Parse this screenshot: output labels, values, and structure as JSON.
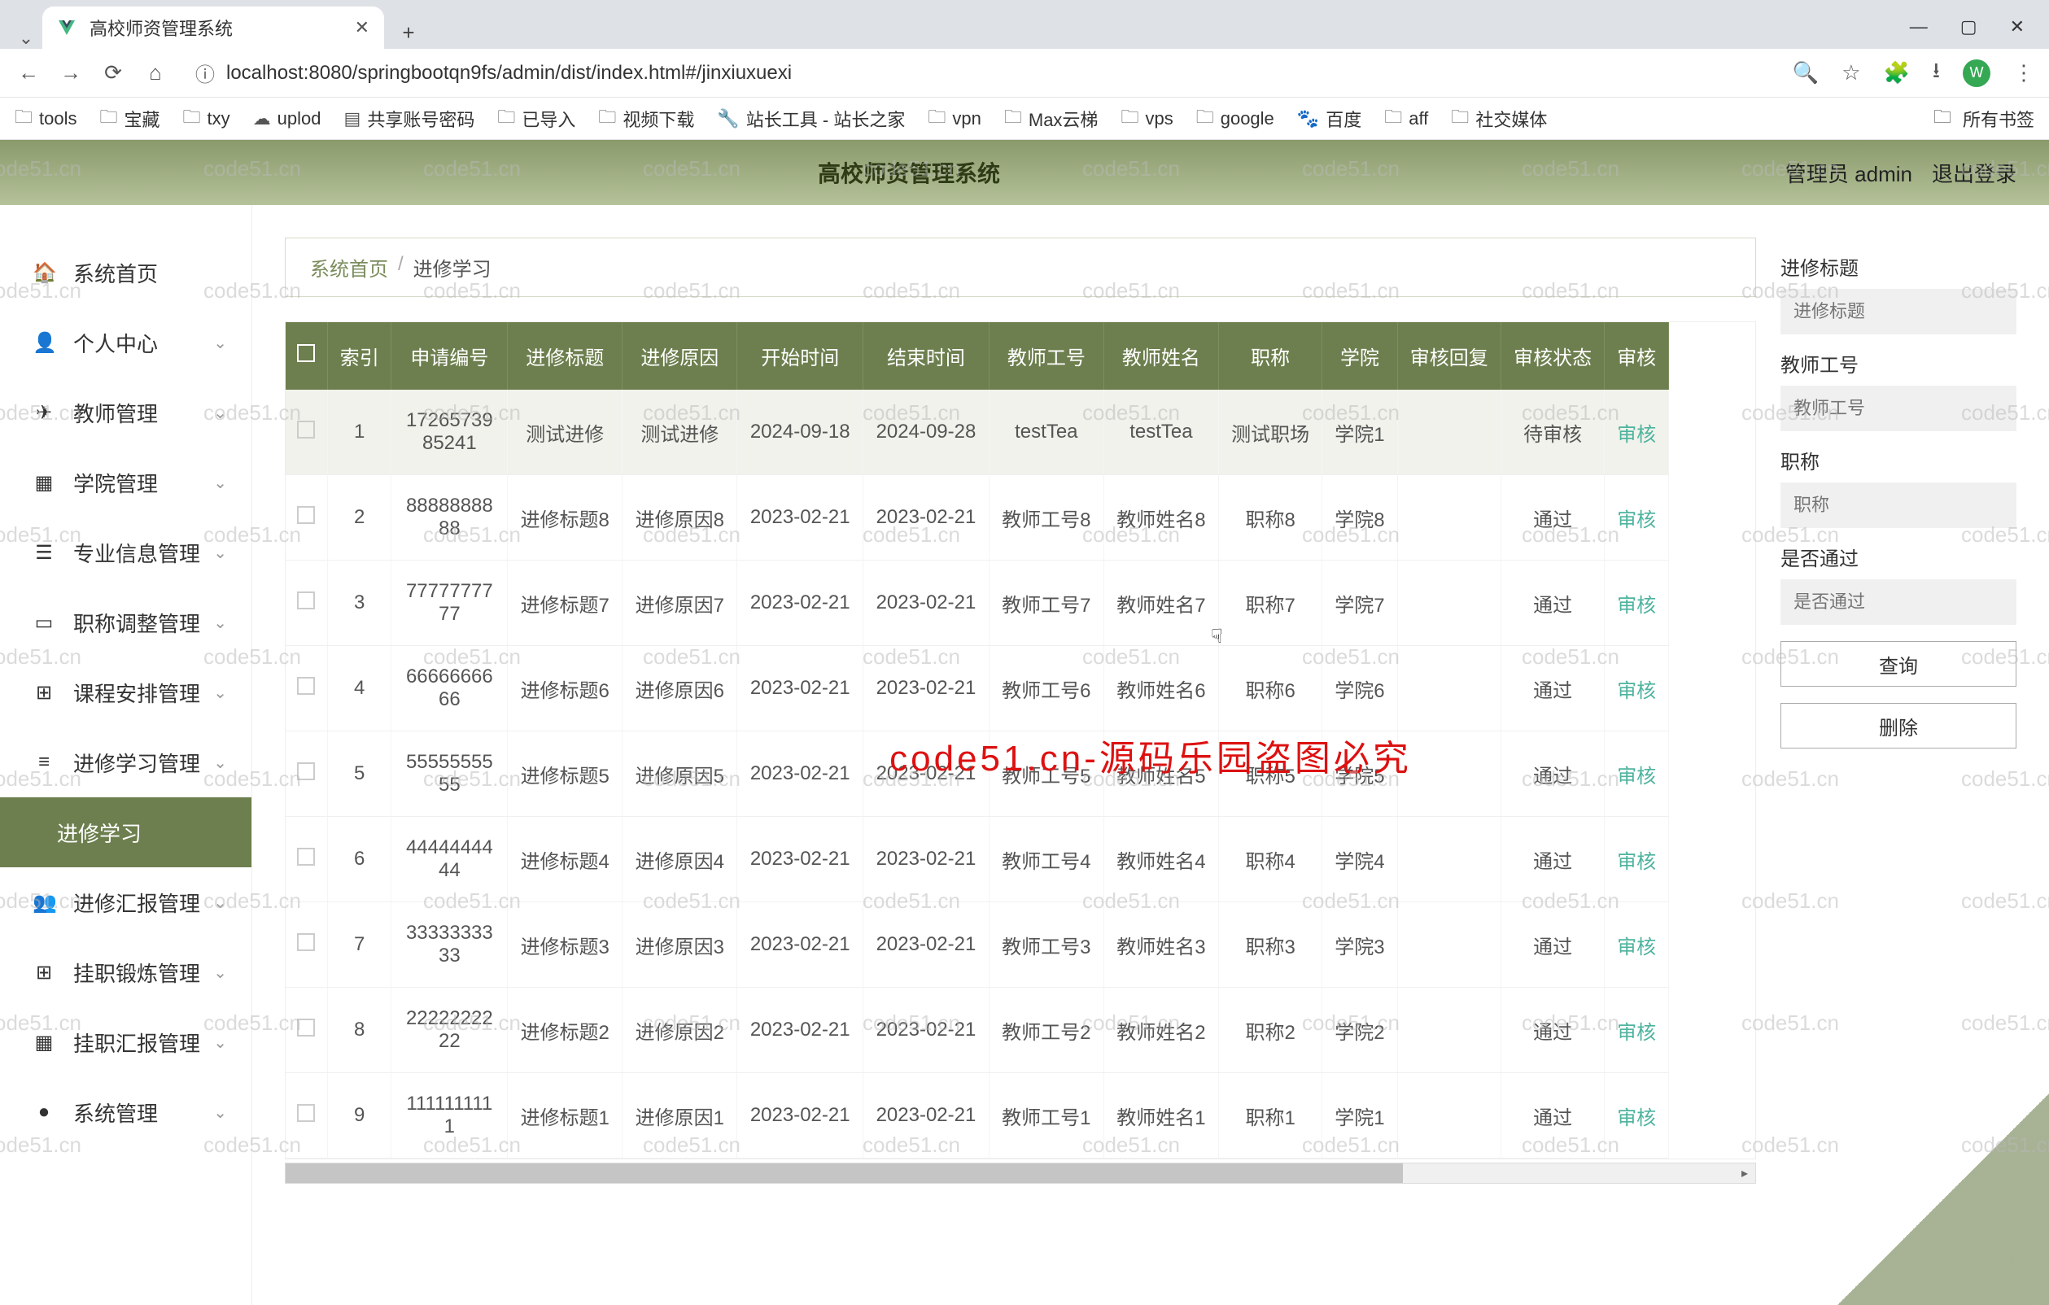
{
  "browser": {
    "tab_title": "高校师资管理系统",
    "url": "localhost:8080/springbootqn9fs/admin/dist/index.html#/jinxiuxuexi",
    "avatar_letter": "W",
    "bookmarks": [
      {
        "label": "tools",
        "icon": "folder"
      },
      {
        "label": "宝藏",
        "icon": "folder"
      },
      {
        "label": "txy",
        "icon": "folder"
      },
      {
        "label": "uplod",
        "icon": "cloud"
      },
      {
        "label": "共享账号密码",
        "icon": "sheet"
      },
      {
        "label": "已导入",
        "icon": "folder"
      },
      {
        "label": "视频下载",
        "icon": "folder"
      },
      {
        "label": "站长工具 - 站长之家",
        "icon": "tool"
      },
      {
        "label": "vpn",
        "icon": "folder"
      },
      {
        "label": "Max云梯",
        "icon": "folder"
      },
      {
        "label": "vps",
        "icon": "folder"
      },
      {
        "label": "google",
        "icon": "folder"
      },
      {
        "label": "百度",
        "icon": "paw"
      },
      {
        "label": "aff",
        "icon": "folder"
      },
      {
        "label": "社交媒体",
        "icon": "folder"
      }
    ],
    "all_bookmarks": "所有书签"
  },
  "app": {
    "title": "高校师资管理系统",
    "user_role": "管理员 admin",
    "logout": "退出登录"
  },
  "sidebar": {
    "items": [
      {
        "label": "系统首页",
        "icon": "🏠",
        "expandable": false
      },
      {
        "label": "个人中心",
        "icon": "👤",
        "expandable": true
      },
      {
        "label": "教师管理",
        "icon": "✈",
        "expandable": true
      },
      {
        "label": "学院管理",
        "icon": "▦",
        "expandable": true
      },
      {
        "label": "专业信息管理",
        "icon": "☰",
        "expandable": true
      },
      {
        "label": "职称调整管理",
        "icon": "▭",
        "expandable": true
      },
      {
        "label": "课程安排管理",
        "icon": "⊞",
        "expandable": true
      },
      {
        "label": "进修学习管理",
        "icon": "≡",
        "expandable": true
      },
      {
        "label": "进修学习",
        "icon": "",
        "expandable": false,
        "active": true,
        "sub": true
      },
      {
        "label": "进修汇报管理",
        "icon": "👥",
        "expandable": true
      },
      {
        "label": "挂职锻炼管理",
        "icon": "⊞",
        "expandable": true
      },
      {
        "label": "挂职汇报管理",
        "icon": "▦",
        "expandable": true
      },
      {
        "label": "系统管理",
        "icon": "●",
        "expandable": true
      }
    ]
  },
  "breadcrumb": {
    "home": "系统首页",
    "current": "进修学习"
  },
  "table": {
    "headers": [
      "",
      "索引",
      "申请编号",
      "进修标题",
      "进修原因",
      "开始时间",
      "结束时间",
      "教师工号",
      "教师姓名",
      "职称",
      "学院",
      "审核回复",
      "审核状态",
      "审核"
    ],
    "rows": [
      {
        "idx": "1",
        "sn": "1726573985241",
        "title": "测试进修",
        "reason": "测试进修",
        "start": "2024-09-18",
        "end": "2024-09-28",
        "tid": "testTea",
        "tname": "testTea",
        "rank": "测试职场",
        "college": "学院1",
        "reply": "",
        "status": "待审核",
        "audit": "审核",
        "sel": true
      },
      {
        "idx": "2",
        "sn": "8888888888",
        "title": "进修标题8",
        "reason": "进修原因8",
        "start": "2023-02-21",
        "end": "2023-02-21",
        "tid": "教师工号8",
        "tname": "教师姓名8",
        "rank": "职称8",
        "college": "学院8",
        "reply": "",
        "status": "通过",
        "audit": "审核"
      },
      {
        "idx": "3",
        "sn": "7777777777",
        "title": "进修标题7",
        "reason": "进修原因7",
        "start": "2023-02-21",
        "end": "2023-02-21",
        "tid": "教师工号7",
        "tname": "教师姓名7",
        "rank": "职称7",
        "college": "学院7",
        "reply": "",
        "status": "通过",
        "audit": "审核"
      },
      {
        "idx": "4",
        "sn": "6666666666",
        "title": "进修标题6",
        "reason": "进修原因6",
        "start": "2023-02-21",
        "end": "2023-02-21",
        "tid": "教师工号6",
        "tname": "教师姓名6",
        "rank": "职称6",
        "college": "学院6",
        "reply": "",
        "status": "通过",
        "audit": "审核"
      },
      {
        "idx": "5",
        "sn": "5555555555",
        "title": "进修标题5",
        "reason": "进修原因5",
        "start": "2023-02-21",
        "end": "2023-02-21",
        "tid": "教师工号5",
        "tname": "教师姓名5",
        "rank": "职称5",
        "college": "学院5",
        "reply": "",
        "status": "通过",
        "audit": "审核"
      },
      {
        "idx": "6",
        "sn": "4444444444",
        "title": "进修标题4",
        "reason": "进修原因4",
        "start": "2023-02-21",
        "end": "2023-02-21",
        "tid": "教师工号4",
        "tname": "教师姓名4",
        "rank": "职称4",
        "college": "学院4",
        "reply": "",
        "status": "通过",
        "audit": "审核"
      },
      {
        "idx": "7",
        "sn": "3333333333",
        "title": "进修标题3",
        "reason": "进修原因3",
        "start": "2023-02-21",
        "end": "2023-02-21",
        "tid": "教师工号3",
        "tname": "教师姓名3",
        "rank": "职称3",
        "college": "学院3",
        "reply": "",
        "status": "通过",
        "audit": "审核"
      },
      {
        "idx": "8",
        "sn": "2222222222",
        "title": "进修标题2",
        "reason": "进修原因2",
        "start": "2023-02-21",
        "end": "2023-02-21",
        "tid": "教师工号2",
        "tname": "教师姓名2",
        "rank": "职称2",
        "college": "学院2",
        "reply": "",
        "status": "通过",
        "audit": "审核"
      },
      {
        "idx": "9",
        "sn": "1111111111",
        "title": "进修标题1",
        "reason": "进修原因1",
        "start": "2023-02-21",
        "end": "2023-02-21",
        "tid": "教师工号1",
        "tname": "教师姓名1",
        "rank": "职称1",
        "college": "学院1",
        "reply": "",
        "status": "通过",
        "audit": "审核"
      }
    ]
  },
  "filter": {
    "labels": {
      "title": "进修标题",
      "tid": "教师工号",
      "rank": "职称",
      "pass": "是否通过"
    },
    "placeholders": {
      "title": "进修标题",
      "tid": "教师工号",
      "rank": "职称",
      "pass": "是否通过"
    },
    "btn_query": "查询",
    "btn_delete": "删除"
  },
  "watermark": {
    "text": "code51.cn",
    "big": "code51.cn-源码乐园盗图必究"
  }
}
